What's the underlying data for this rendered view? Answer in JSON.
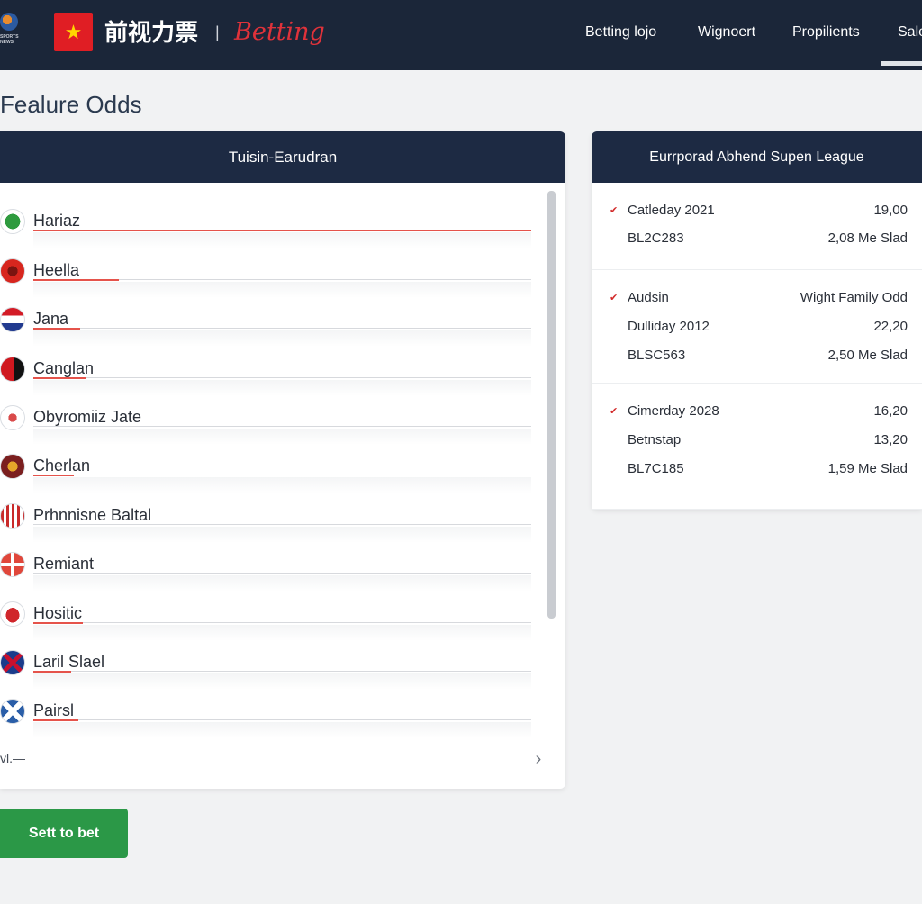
{
  "header": {
    "badge_text": "SPORTS NEWS",
    "brand_cn": "前视力票",
    "brand_sep": "|",
    "brand_script": "Betting",
    "nav": [
      "Betting lojo",
      "Wignoert",
      "Propilients",
      "Sale"
    ],
    "colors": {
      "bar": "#1b2639",
      "brand_red": "#e0323a"
    }
  },
  "page": {
    "title": "Fealure Odds"
  },
  "left_panel": {
    "title": "Tuisin-Earudran",
    "teams": [
      {
        "name": "Hariaz",
        "icon": "green-dot-crest"
      },
      {
        "name": "Heella",
        "icon": "red-crest"
      },
      {
        "name": "Jana",
        "icon": "red-white-blue-flag"
      },
      {
        "name": "Canglan",
        "icon": "red-black-crest"
      },
      {
        "name": "Obyromiiz Jate",
        "icon": "star-crest"
      },
      {
        "name": "Cherlan",
        "icon": "lion-crest"
      },
      {
        "name": "Prhnnisne Baltal",
        "icon": "striped-crest"
      },
      {
        "name": "Remiant",
        "icon": "cross-crest"
      },
      {
        "name": "Hositic",
        "icon": "red-eagle-crest"
      },
      {
        "name": "Laril Slael",
        "icon": "union-flag"
      },
      {
        "name": "Pairsl",
        "icon": "saltire-crest"
      }
    ],
    "pager_text": "vl.—",
    "next_icon": "chevron-right-icon"
  },
  "cta": {
    "label": "Sett to bet",
    "color": "#2b9847"
  },
  "right_panel": {
    "title": "Eurrporad Abhend Supen League",
    "blocks": [
      {
        "rows": [
          {
            "label": "Catleday 2021",
            "value": "19,00",
            "marker": true
          },
          {
            "label": "BL2C283",
            "value": "2,08 Me Slad",
            "marker": false
          }
        ]
      },
      {
        "rows": [
          {
            "label": "Audsin",
            "value": "Wight Family Odd",
            "marker": true
          },
          {
            "label": "Dulliday 2012",
            "value": "22,20",
            "marker": false
          },
          {
            "label": "BLSC563",
            "value": "2,50 Me Slad",
            "marker": false
          }
        ]
      },
      {
        "rows": [
          {
            "label": "Cimerday 2028",
            "value": "16,20",
            "marker": true
          },
          {
            "label": "Betnstap",
            "value": "13,20",
            "marker": false
          },
          {
            "label": "BL7C185",
            "value": "1,59 Me Slad",
            "marker": false
          }
        ]
      }
    ]
  }
}
